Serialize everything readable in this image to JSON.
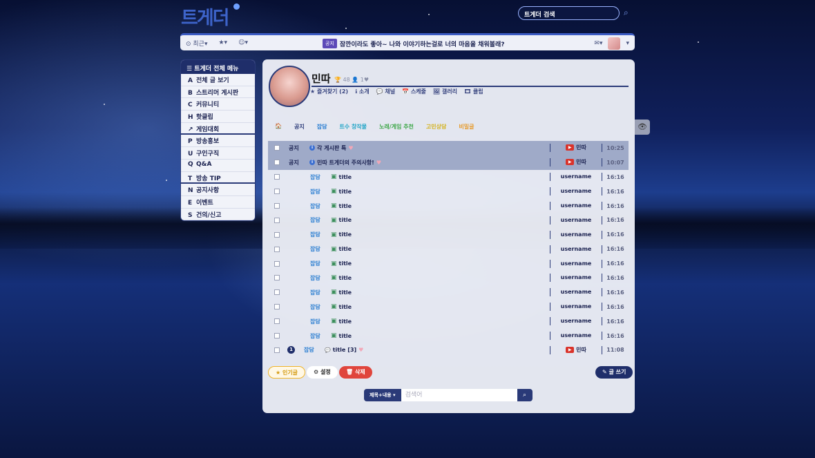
{
  "site": {
    "logo": "트게더",
    "search_placeholder": "트게더 검색"
  },
  "topbar": {
    "recent": "⊙ 최근▾",
    "favorites": "★▾",
    "emoji": "☺▾",
    "notice_badge": "공지",
    "notice_text": "잠깐이라도 좋아~ 나와 이야기하는걸로 너의 마음을 채워볼래?",
    "mail": "✉▾"
  },
  "sidebar": {
    "title": "☰  트게더 전체 메뉴",
    "items": [
      {
        "key": "A",
        "label": "전체 글 보기"
      },
      {
        "key": "B",
        "label": "스트리머 게시판"
      },
      {
        "key": "C",
        "label": "커뮤니티"
      },
      {
        "key": "H",
        "label": "핫클립"
      },
      {
        "key": "↗",
        "label": "게임대회"
      },
      {
        "key": "P",
        "label": "방송홍보"
      },
      {
        "key": "U",
        "label": "구인구직"
      },
      {
        "key": "Q",
        "label": "Q&A"
      },
      {
        "key": "T",
        "label": "방송 TIP"
      },
      {
        "key": "N",
        "label": "공지사항"
      },
      {
        "key": "E",
        "label": "이벤트"
      },
      {
        "key": "S",
        "label": "건의/신고"
      }
    ]
  },
  "profile": {
    "name": "민따",
    "stats": "🏆 48  👤 1♥",
    "links": [
      "★ 즐겨찾기 (2)",
      "ℹ 소개",
      "💬 채널",
      "📅 스케줄",
      "🖼 갤러리",
      "🎞 클립"
    ]
  },
  "tabs": [
    {
      "label": "🏠",
      "color": "#2a3a78"
    },
    {
      "label": "공지",
      "color": "#2a3a78"
    },
    {
      "label": "잡담",
      "color": "#2a7ed1"
    },
    {
      "label": "트수 창작물",
      "color": "#27a6c8"
    },
    {
      "label": "노래/게임 추천",
      "color": "#3fa84a"
    },
    {
      "label": "고민상담",
      "color": "#d4b21f"
    },
    {
      "label": "비밀글",
      "color": "#e69b2c"
    }
  ],
  "posts": {
    "notices": [
      {
        "cat": "공지",
        "title": "각 게시판 특",
        "author": "민따",
        "time": "10:25"
      },
      {
        "cat": "공지",
        "title": "민따 트게더의 주의사항!",
        "author": "민따",
        "time": "10:07"
      }
    ],
    "rows": [
      {
        "cat": "잡담",
        "title": "title",
        "author": "username",
        "time": "16:16"
      },
      {
        "cat": "잡담",
        "title": "title",
        "author": "username",
        "time": "16:16"
      },
      {
        "cat": "잡담",
        "title": "title",
        "author": "username",
        "time": "16:16"
      },
      {
        "cat": "잡담",
        "title": "title",
        "author": "username",
        "time": "16:16"
      },
      {
        "cat": "잡담",
        "title": "title",
        "author": "username",
        "time": "16:16"
      },
      {
        "cat": "잡담",
        "title": "title",
        "author": "username",
        "time": "16:16"
      },
      {
        "cat": "잡담",
        "title": "title",
        "author": "username",
        "time": "16:16"
      },
      {
        "cat": "잡담",
        "title": "title",
        "author": "username",
        "time": "16:16"
      },
      {
        "cat": "잡담",
        "title": "title",
        "author": "username",
        "time": "16:16"
      },
      {
        "cat": "잡담",
        "title": "title",
        "author": "username",
        "time": "16:16"
      },
      {
        "cat": "잡담",
        "title": "title",
        "author": "username",
        "time": "16:16"
      },
      {
        "cat": "잡담",
        "title": "title",
        "author": "username",
        "time": "16:16"
      }
    ],
    "last": {
      "num": "1",
      "cat": "잡담",
      "title": "title",
      "comments": "[3]",
      "author": "민따",
      "time": "11:08"
    }
  },
  "actions": {
    "popular": "★ 인기글",
    "settings": "⚙ 설정",
    "delete": "🗑 삭제",
    "write": "✎ 글 쓰기"
  },
  "search": {
    "scope": "제목+내용 ▾",
    "placeholder": "검색어"
  }
}
